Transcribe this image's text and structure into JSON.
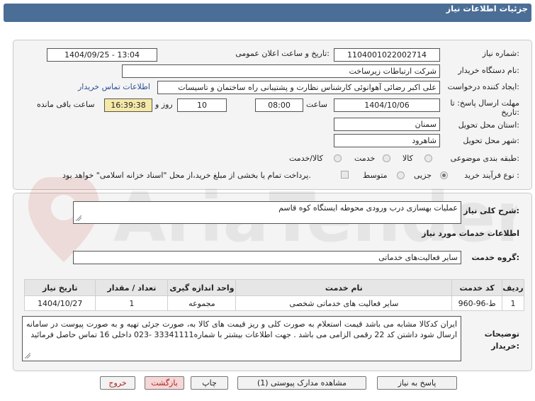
{
  "header": {
    "title": "جزئیات اطلاعات نیاز"
  },
  "form": {
    "need_number": {
      "label": "شماره نیاز:",
      "value": "1104001022002714"
    },
    "announce_datetime": {
      "label": "تاریخ و ساعت اعلان عمومی:",
      "value": "1404/09/25 - 13:04"
    },
    "buyer_org": {
      "label": "نام دستگاه خریدار:",
      "value": "شرکت ارتباطات زیرساخت"
    },
    "creator": {
      "label": "ایجاد کننده درخواست:",
      "value": "علی اکبر رضائی آهوانوئی کارشناس نظارت و پشتیبانی راه ساختمان و تاسیسات",
      "contact_link": "اطلاعات تماس خریدار"
    },
    "deadline": {
      "label": "مهلت ارسال پاسخ: تا تاریخ:",
      "date": "1404/10/06",
      "time_label": "ساعت",
      "time": "08:00",
      "days": "10",
      "days_label": "روز و",
      "remaining": "16:39:38",
      "remaining_label": "ساعت باقی مانده"
    },
    "province": {
      "label": "استان محل تحویل:",
      "value": "سمنان"
    },
    "city": {
      "label": "شهر محل تحویل:",
      "value": "شاهرود"
    },
    "category": {
      "label": "طبقه بندی موضوعی:",
      "options": [
        "کالا",
        "خدمت",
        "کالا/خدمت"
      ]
    },
    "process": {
      "label": "نوع فرآیند خرید :",
      "options": [
        "جزیی",
        "متوسط"
      ],
      "treasury_note": "پرداخت تمام یا بخشی از مبلغ خرید،از محل \"اسناد خزانه اسلامی\" خواهد بود."
    }
  },
  "summary": {
    "label": "شرح کلی نیاز:",
    "value": "عملیات بهسازی درب ورودی محوطه ایستگاه کوه قاسم"
  },
  "services": {
    "title": "اطلاعات خدمات مورد نیاز",
    "group_label": "گروه خدمت:",
    "group_value": "سایر فعالیت‌های خدماتی",
    "columns": [
      "ردیف",
      "کد خدمت",
      "نام خدمت",
      "واحد اندازه گیری",
      "تعداد / مقدار",
      "تاریخ نیاز"
    ],
    "rows": [
      [
        "1",
        "ط-96-960",
        "سایر فعالیت های خدماتی شخصی",
        "مجموعه",
        "1",
        "1404/10/27"
      ]
    ]
  },
  "buyer_notes": {
    "label": "توضیحات خریدار:",
    "value": "ایران کدکالا مشابه می باشد قیمت استعلام به صورت کلی و ریز قیمت های کالا به، صورت جزئی تهیه و به صورت پیوست در سامانه ارسال شود داشتن کد 22 رقمی الزامی می باشد . جهت اطلاعات بیشتر با شماره33341111 -023 داخلی 16 تماس حاصل فرمائید"
  },
  "buttons": {
    "reply": "پاسخ به نیاز",
    "attachments": "مشاهده مدارک پیوستی (1)",
    "print": "چاپ",
    "back": "بازگشت",
    "exit": "خروج"
  },
  "watermark": {
    "text": "AriaTender.net"
  },
  "colors": {
    "header_bg": "#4a6e96",
    "link": "#2a4f9a",
    "exit_text": "#b02020",
    "panel_bg": "#f4f4f4"
  }
}
